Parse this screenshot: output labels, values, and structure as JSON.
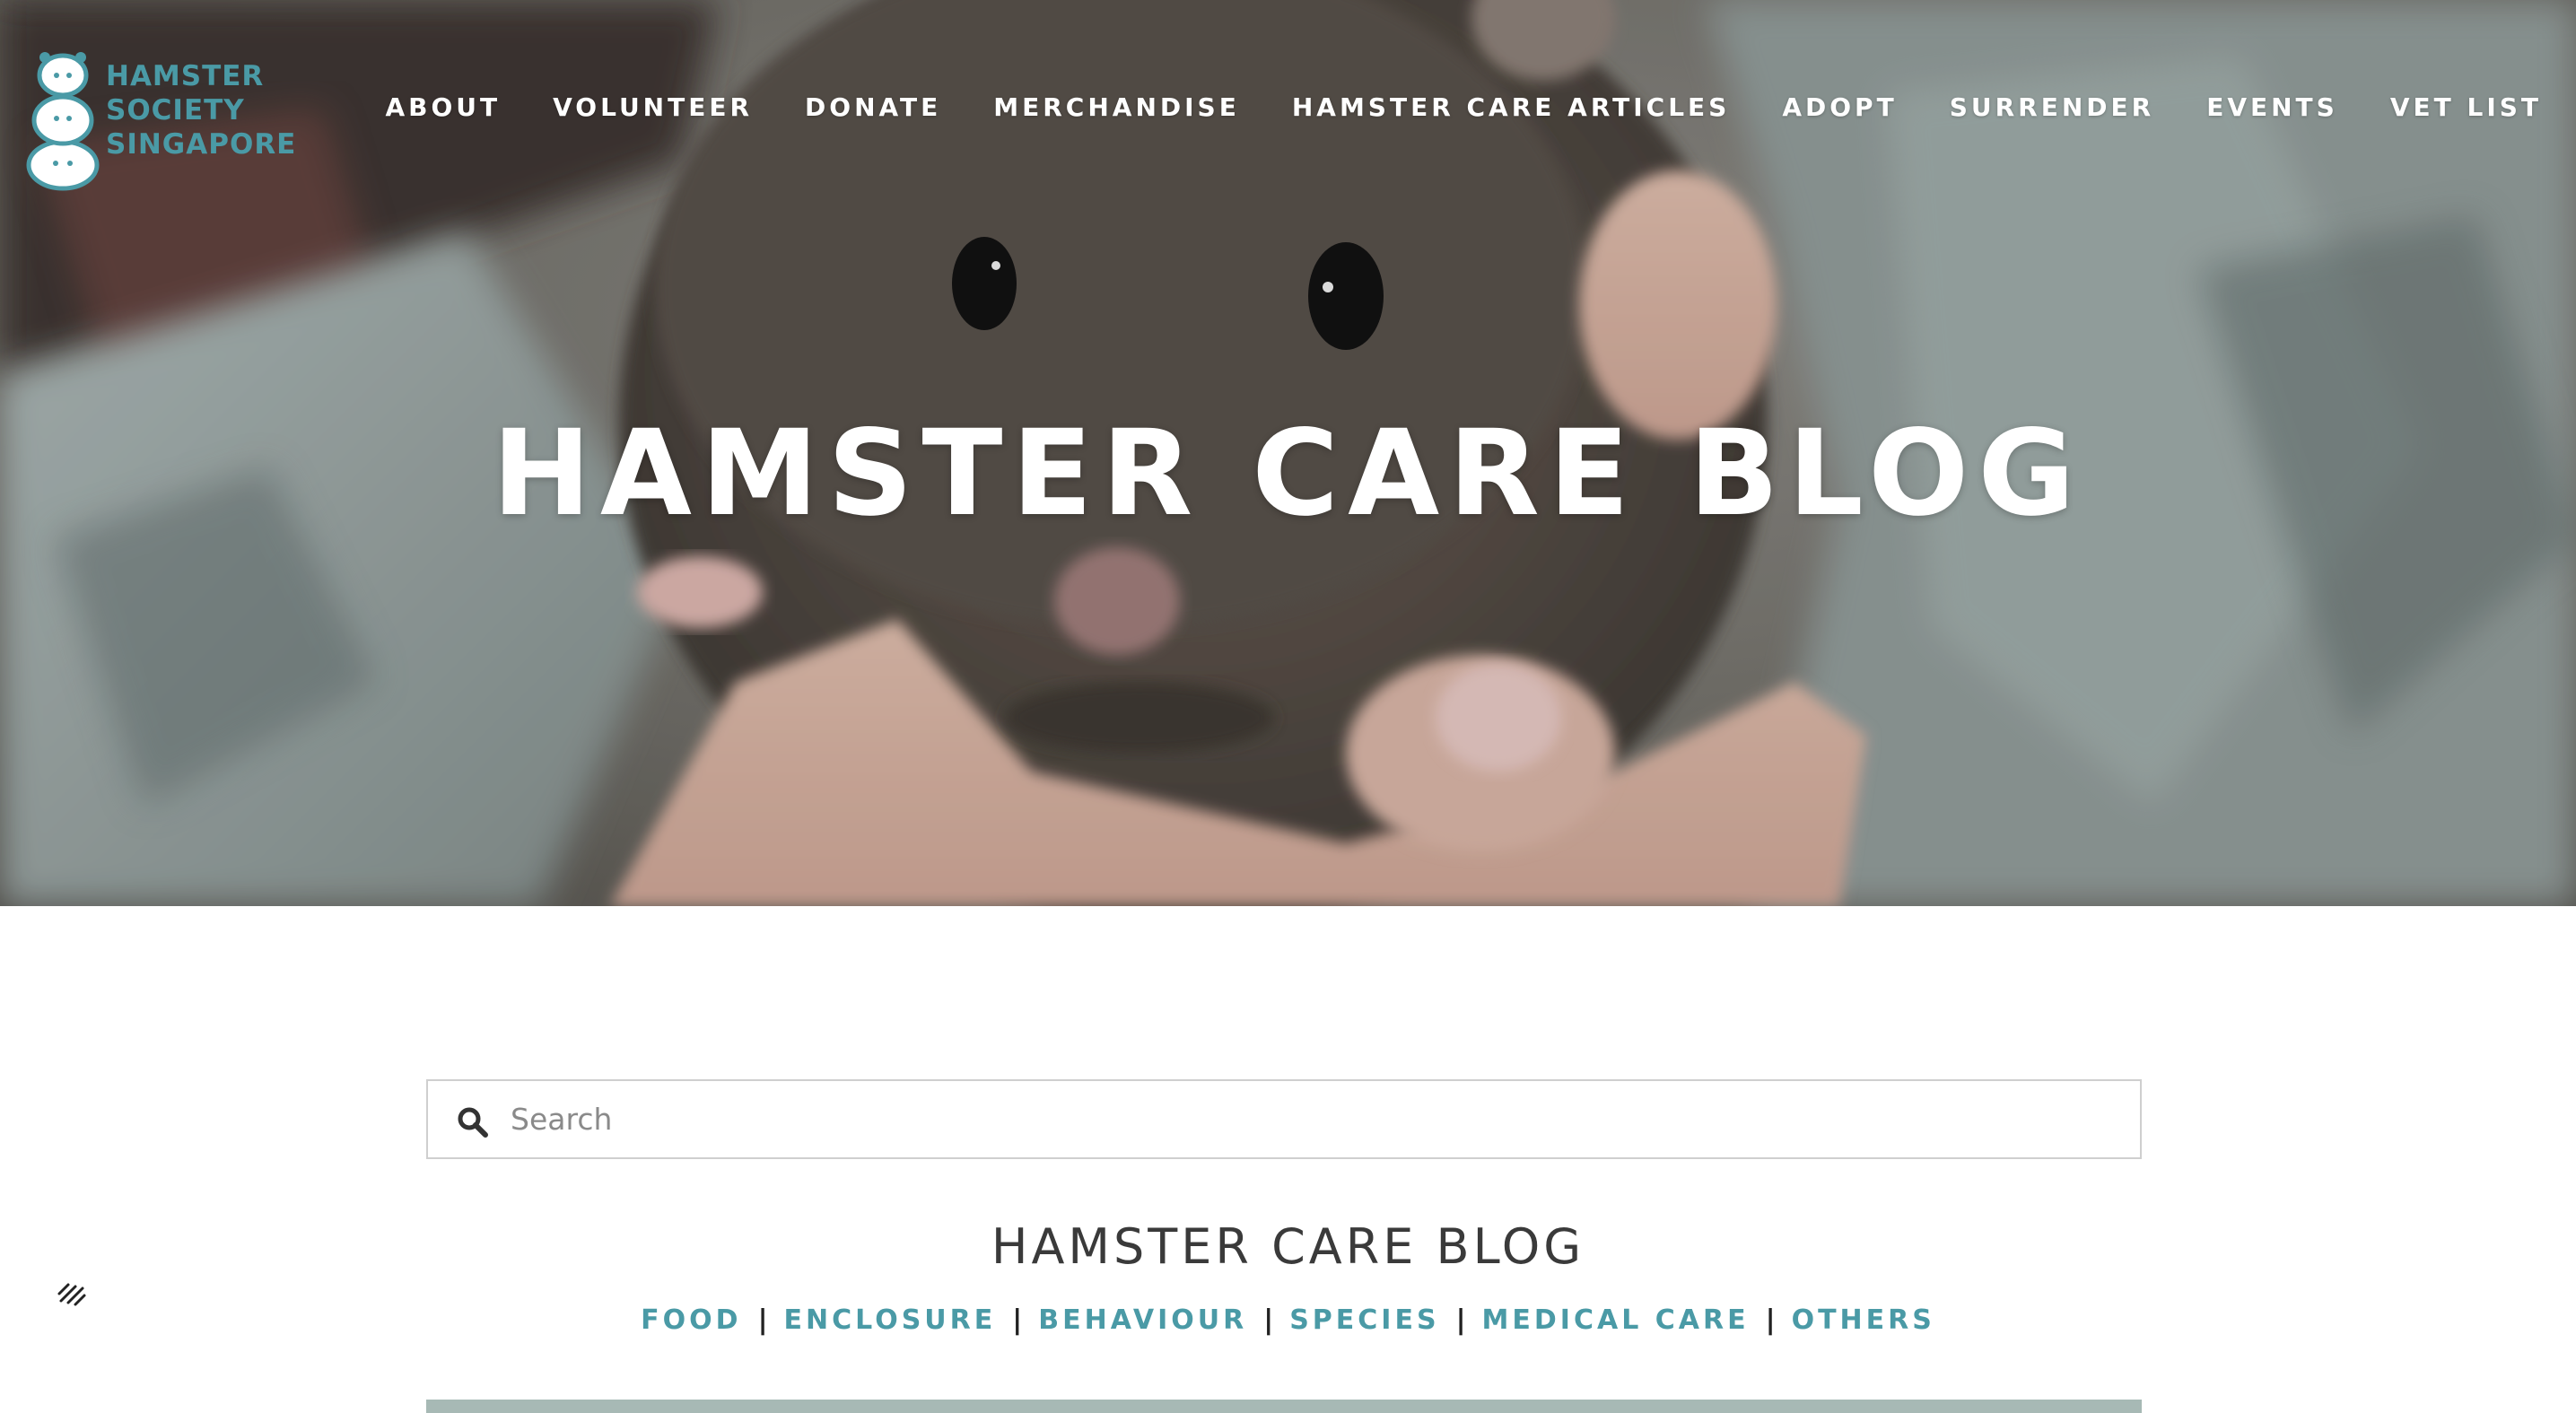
{
  "logo": {
    "line1": "HAMSTER",
    "line2": "SOCIETY",
    "line3": "SINGAPORE"
  },
  "nav": [
    {
      "label": "ABOUT"
    },
    {
      "label": "VOLUNTEER"
    },
    {
      "label": "DONATE"
    },
    {
      "label": "MERCHANDISE"
    },
    {
      "label": "HAMSTER CARE ARTICLES"
    },
    {
      "label": "ADOPT"
    },
    {
      "label": "SURRENDER"
    },
    {
      "label": "EVENTS"
    },
    {
      "label": "VET LIST"
    }
  ],
  "hero": {
    "title": "HAMSTER CARE BLOG"
  },
  "search": {
    "placeholder": "Search"
  },
  "blog": {
    "heading": "HAMSTER CARE BLOG",
    "categories": [
      {
        "label": "FOOD"
      },
      {
        "label": "ENCLOSURE"
      },
      {
        "label": "BEHAVIOUR"
      },
      {
        "label": "SPECIES"
      },
      {
        "label": "MEDICAL CARE"
      },
      {
        "label": "OTHERS"
      }
    ],
    "separator": "|"
  },
  "colors": {
    "brand_teal": "#4a9aa6",
    "hero_text": "#ffffff",
    "heading_text": "#3a3a3a"
  },
  "icons": {
    "search": "search-icon",
    "squarespace": "squarespace-logo-icon"
  }
}
